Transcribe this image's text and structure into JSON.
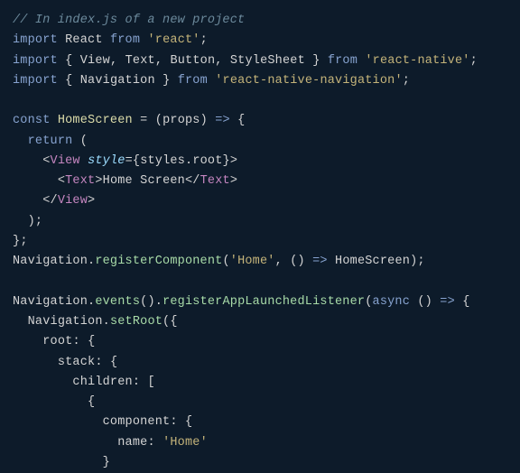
{
  "code": {
    "comment": "// In index.js of a new project",
    "line1": {
      "import": "import",
      "react": "React",
      "from": "from",
      "str": "'react'"
    },
    "line2": {
      "import": "import",
      "view": "View",
      "text": "Text",
      "button": "Button",
      "stylesheet": "StyleSheet",
      "from": "from",
      "str": "'react-native'"
    },
    "line3": {
      "import": "import",
      "nav": "Navigation",
      "from": "from",
      "str": "'react-native-navigation'"
    },
    "line5": {
      "const": "const",
      "name": "HomeScreen",
      "props": "props"
    },
    "line6": {
      "return": "return"
    },
    "line7": {
      "view": "View",
      "style": "style",
      "styles": "styles",
      "root": "root"
    },
    "line8": {
      "text": "Text",
      "content": "Home Screen",
      "textClose": "Text"
    },
    "line9": {
      "view": "View"
    },
    "line12": {
      "nav": "Navigation",
      "method": "registerComponent",
      "str": "'Home'",
      "hs": "HomeScreen"
    },
    "line14": {
      "nav": "Navigation",
      "events": "events",
      "method": "registerAppLaunchedListener",
      "async": "async"
    },
    "line15": {
      "nav": "Navigation",
      "method": "setRoot"
    },
    "line16": {
      "root": "root"
    },
    "line17": {
      "stack": "stack"
    },
    "line18": {
      "children": "children"
    },
    "line20": {
      "component": "component"
    },
    "line21": {
      "name": "name",
      "str": "'Home'"
    }
  }
}
